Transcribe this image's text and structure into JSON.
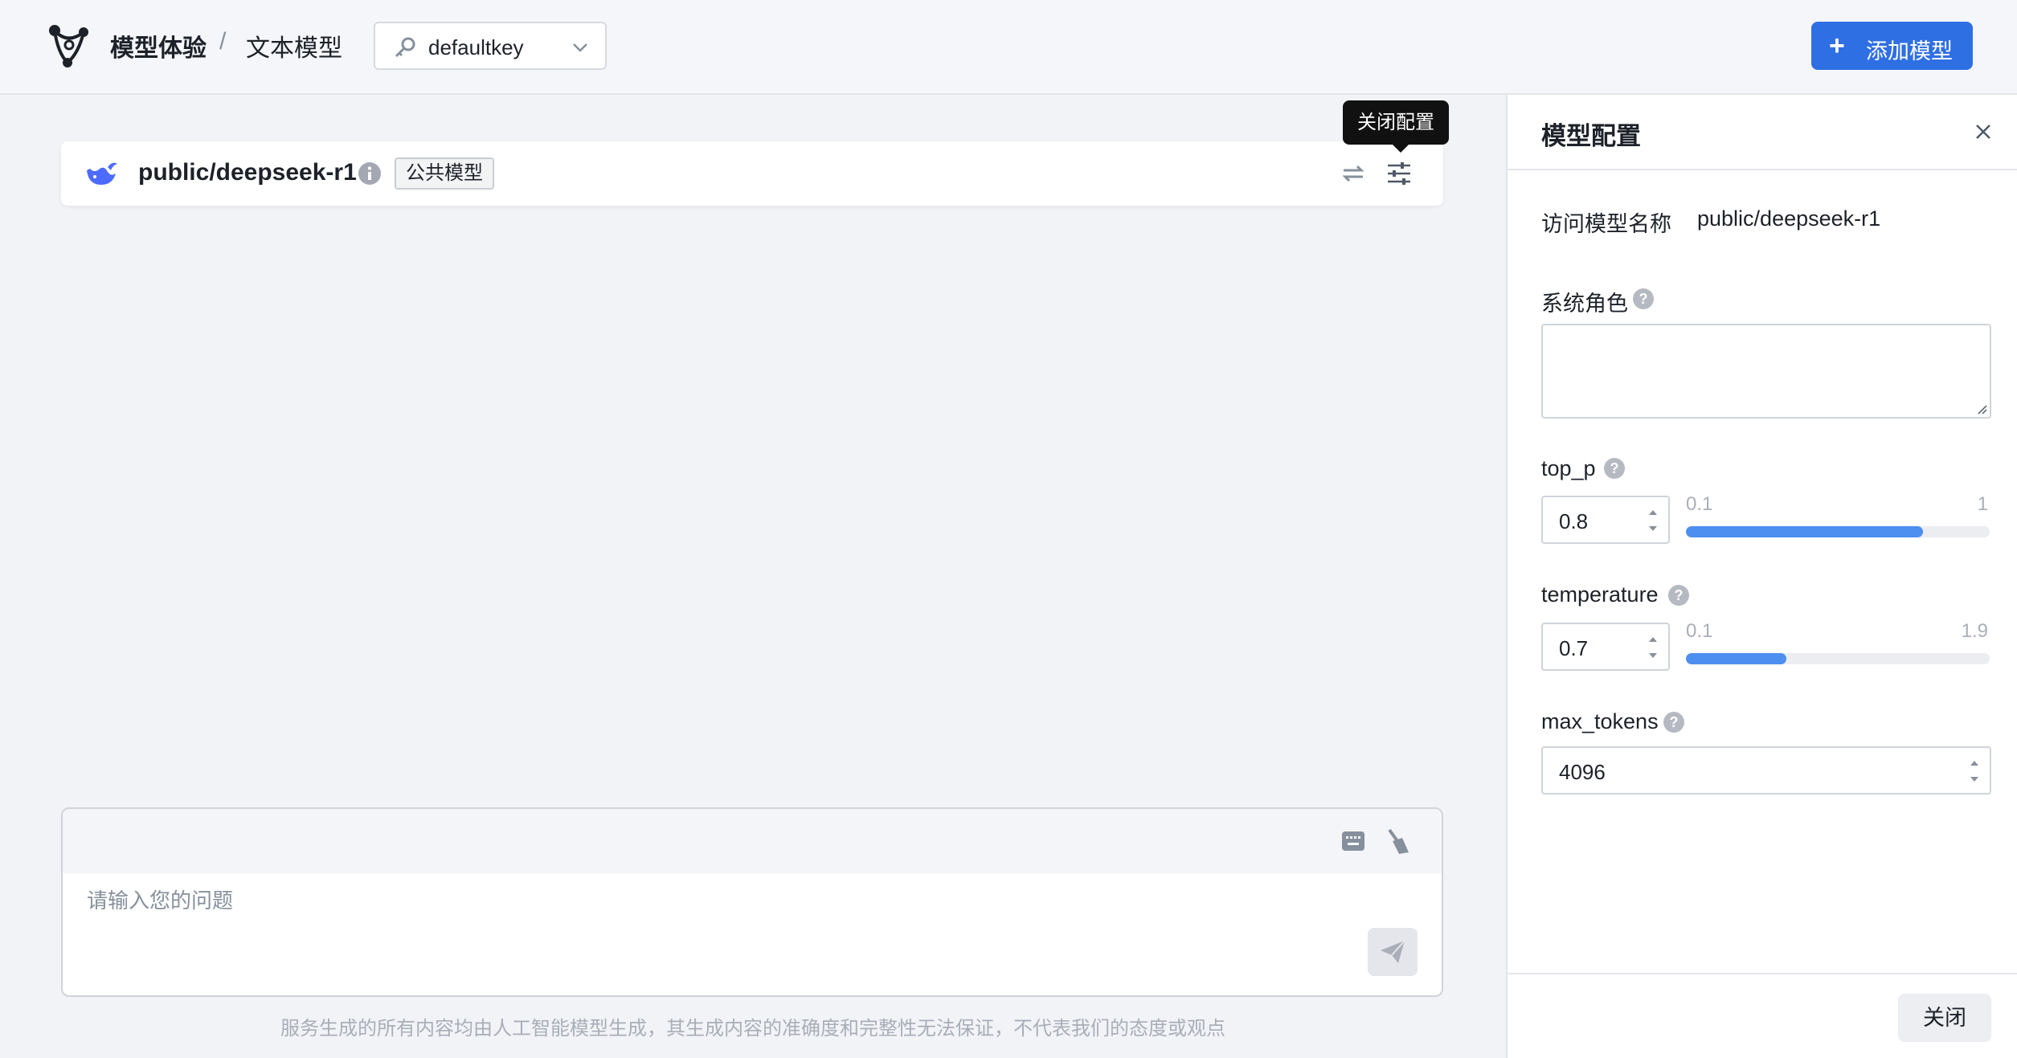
{
  "header": {
    "breadcrumb_root": "模型体验",
    "breadcrumb_sep": "/",
    "breadcrumb_current": "文本模型",
    "key_select_value": "defaultkey",
    "add_button_label": "添加模型",
    "add_button_icon": "+"
  },
  "model_card": {
    "name": "public/deepseek-r1",
    "tag": "公共模型",
    "tooltip": "关闭配置"
  },
  "chat": {
    "placeholder": "请输入您的问题",
    "disclaimer": "服务生成的所有内容均由人工智能模型生成，其生成内容的准确度和完整性无法保证，不代表我们的态度或观点"
  },
  "panel": {
    "title": "模型配置",
    "model_name_label": "访问模型名称",
    "model_name_value": "public/deepseek-r1",
    "system_role_label": "系统角色",
    "help_glyph": "?",
    "top_p": {
      "label": "top_p",
      "value": "0.8",
      "min": "0.1",
      "max": "1",
      "fill_fraction": 0.78
    },
    "temperature": {
      "label": "temperature",
      "value": "0.7",
      "min": "0.1",
      "max": "1.9",
      "fill_fraction": 0.33
    },
    "max_tokens": {
      "label": "max_tokens",
      "value": "4096"
    },
    "close_label": "关闭"
  },
  "colors": {
    "primary": "#2f6fe4",
    "slider_fill": "#4d8ff0",
    "tooltip_bg": "#111111"
  }
}
